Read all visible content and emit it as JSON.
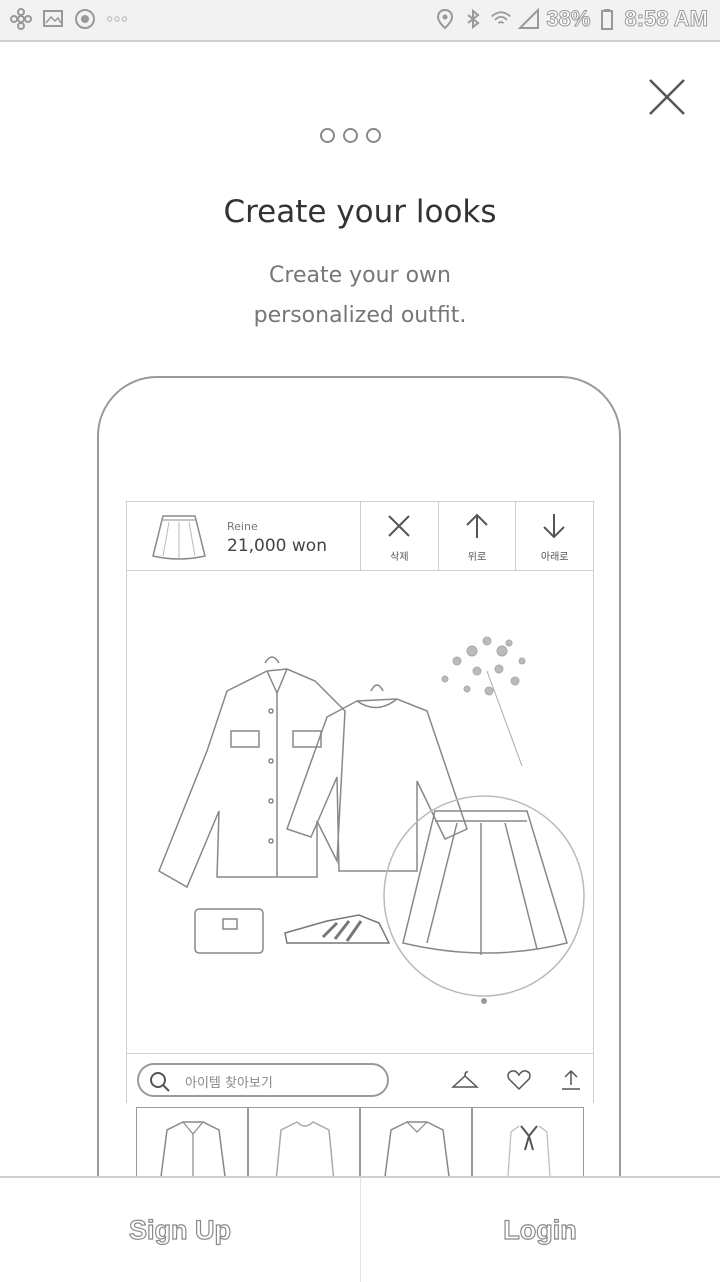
{
  "status_bar": {
    "battery": "38%",
    "time": "8:58 AM",
    "left_icons": [
      "pinwheel-icon",
      "photo-icon",
      "record-icon",
      "more-dots-icon"
    ],
    "right_icons": [
      "location-icon",
      "bluetooth-icon",
      "wifi-icon",
      "signal-icon",
      "battery-icon"
    ]
  },
  "onboarding": {
    "title": "Create your looks",
    "subtitle_line1": "Create your own",
    "subtitle_line2": "personalized outfit.",
    "page_count": 3
  },
  "mockup": {
    "item": {
      "brand": "Reine",
      "price": "21,000 won"
    },
    "actions": [
      {
        "label": "삭제",
        "icon": "x-icon"
      },
      {
        "label": "위로",
        "icon": "arrow-up-icon"
      },
      {
        "label": "아래로",
        "icon": "arrow-down-icon"
      }
    ],
    "search_placeholder": "아이템 찾아보기",
    "toolbar_icons": [
      "hanger-icon",
      "heart-icon",
      "upload-icon"
    ]
  },
  "bottom": {
    "signup_label": "Sign Up",
    "login_label": "Login"
  },
  "colors": {
    "line": "#9a9a9a",
    "text": "#333333",
    "background": "#ffffff"
  }
}
